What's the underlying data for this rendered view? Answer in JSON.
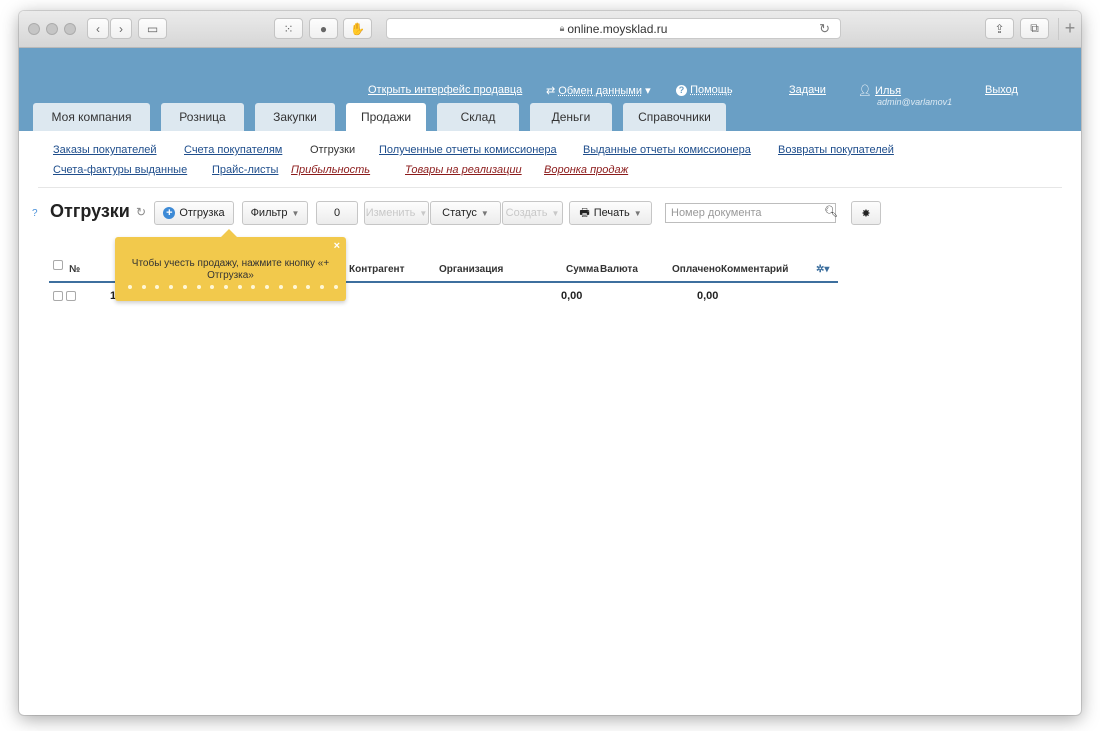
{
  "browser": {
    "url": "online.moysklad.ru",
    "lock_icon": "lock-icon"
  },
  "header": {
    "seller_link": "Открыть интерфейс продавца",
    "exchange_link": "Обмен данными",
    "help_link": "Помощь",
    "tasks_link": "Задачи",
    "user_name": "Илья",
    "user_login": "admin@varlamov1",
    "logout_link": "Выход"
  },
  "tabs": [
    {
      "label": "Моя компания"
    },
    {
      "label": "Розница"
    },
    {
      "label": "Закупки"
    },
    {
      "label": "Продажи"
    },
    {
      "label": "Склад"
    },
    {
      "label": "Деньги"
    },
    {
      "label": "Справочники"
    }
  ],
  "active_tab": "Продажи",
  "subnav": {
    "row1": [
      "Заказы покупателей",
      "Счета покупателям",
      "Отгрузки",
      "Полученные отчеты комиссионера",
      "Выданные отчеты комиссионера",
      "Возвраты покупателей"
    ],
    "row2": [
      "Счета-фактуры выданные",
      "Прайс-листы",
      "Прибыльность",
      "Товары на реализации",
      "Воронка продаж"
    ]
  },
  "page": {
    "title": "Отгрузки",
    "add_button": "Отгрузка",
    "filter_button": "Фильтр",
    "count": "0",
    "edit_button": "Изменить",
    "status_button": "Статус",
    "create_button": "Создать",
    "print_button": "Печать",
    "search_placeholder": "Номер документа"
  },
  "table": {
    "columns": [
      "№",
      "Контрагент",
      "Организация",
      "Сумма",
      "Валюта",
      "Оплачено",
      "Комментарий"
    ],
    "row_number": "1",
    "sum": "0,00",
    "paid": "0,00"
  },
  "tooltip": {
    "text": "Чтобы учесть продажу, нажмите кнопку «+ Отгрузка»",
    "close": "×"
  },
  "colors": {
    "header_bg": "#6a9fc5",
    "tooltip_bg": "#f2c94c",
    "link": "#1f4e8c",
    "italic_link": "#8b1a1a"
  }
}
